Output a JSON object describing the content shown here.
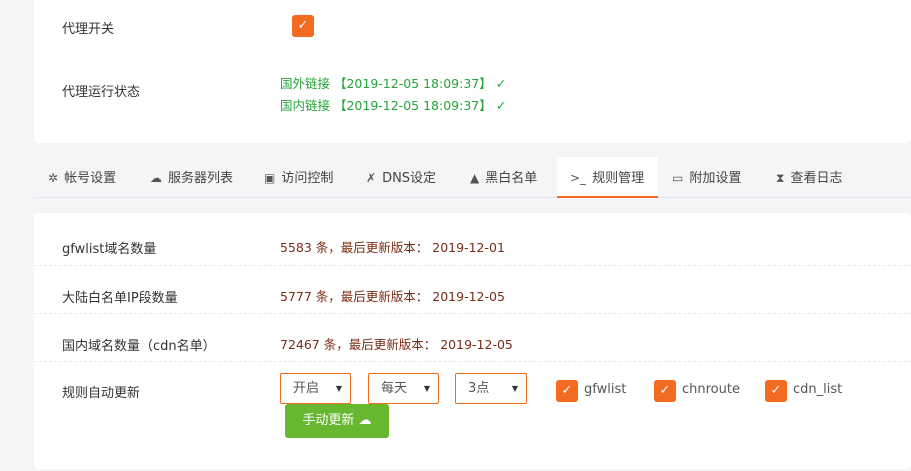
{
  "proxy": {
    "switch_label": "代理开关",
    "switch_checked": true,
    "status_label": "代理运行状态",
    "status_foreign": "国外链接 【2019-12-05 18:09:37】 ✓",
    "status_domestic": "国内链接 【2019-12-05 18:09:37】 ✓"
  },
  "tabs": [
    {
      "label": "帐号设置",
      "icon": "gear-icon",
      "glyph": "✲"
    },
    {
      "label": "服务器列表",
      "icon": "cloud-icon",
      "glyph": "☁"
    },
    {
      "label": "访问控制",
      "icon": "lock-icon",
      "glyph": "🔒"
    },
    {
      "label": "DNS设定",
      "icon": "tools-icon",
      "glyph": "✗"
    },
    {
      "label": "黑白名单",
      "icon": "warning-icon",
      "glyph": "▲"
    },
    {
      "label": "规则管理",
      "icon": "terminal-icon",
      "glyph": ">_",
      "active": true
    },
    {
      "label": "附加设置",
      "icon": "monitor-icon",
      "glyph": "▭"
    },
    {
      "label": "查看日志",
      "icon": "hourglass-icon",
      "glyph": "⧗"
    }
  ],
  "rules": {
    "gfwlist_label": "gfwlist域名数量",
    "gfwlist_value": "5583 条，最后更新版本： 2019-12-01",
    "whitelist_label": "大陆白名单IP段数量",
    "whitelist_value": "5777 条，最后更新版本： 2019-12-05",
    "cdn_label": "国内域名数量（cdn名单）",
    "cdn_value": "72467 条，最后更新版本： 2019-12-05",
    "auto_update_label": "规则自动更新",
    "enable_select": "开启",
    "frequency_select": "每天",
    "hour_select": "3点",
    "options": [
      {
        "label": "gfwlist",
        "checked": true
      },
      {
        "label": "chnroute",
        "checked": true
      },
      {
        "label": "cdn_list",
        "checked": true
      }
    ],
    "manual_update_button": "手动更新 ☁"
  },
  "colors": {
    "accent": "#f26b21",
    "success": "#24a43a",
    "value_text": "#7a2d16",
    "button": "#67b72f"
  }
}
